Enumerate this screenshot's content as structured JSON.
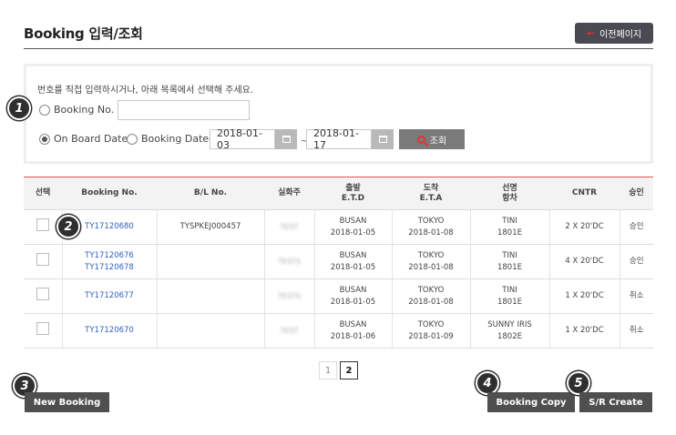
{
  "header": {
    "title": "Booking 입력/조회",
    "back_label": "이전페이지"
  },
  "search": {
    "hint": "번호를 직접 입력하시거나, 아래 목록에서 선택해 주세요.",
    "booking_no_label": "Booking No.",
    "booking_no_value": "",
    "on_board_label": "On Board Date",
    "booking_date_label": "Booking Date",
    "date_from": "2018-01-03",
    "tilde": "~",
    "date_to": "2018-01-17",
    "search_label": "조회"
  },
  "table": {
    "headers": [
      {
        "l1": "선택",
        "l2": ""
      },
      {
        "l1": "Booking No.",
        "l2": ""
      },
      {
        "l1": "B/L No.",
        "l2": ""
      },
      {
        "l1": "실화주",
        "l2": ""
      },
      {
        "l1": "출발",
        "l2": "E.T.D"
      },
      {
        "l1": "도착",
        "l2": "E.T.A"
      },
      {
        "l1": "선명",
        "l2": "항차"
      },
      {
        "l1": "CNTR",
        "l2": ""
      },
      {
        "l1": "승인",
        "l2": ""
      }
    ],
    "rows": [
      {
        "booking1": "TY17120680",
        "booking2": "",
        "bl": "TYSPKEJ000457",
        "shipper": "TEST",
        "etd_port": "BUSAN",
        "etd_date": "2018-01-05",
        "eta_port": "TOKYO",
        "eta_date": "2018-01-08",
        "vessel": "TINI",
        "voyage": "1801E",
        "cntr": "2 X 20'DC",
        "status": "승인"
      },
      {
        "booking1": "TY17120676",
        "booking2": "TY17120678",
        "bl": "",
        "shipper": "TESTS",
        "etd_port": "BUSAN",
        "etd_date": "2018-01-05",
        "eta_port": "TOKYO",
        "eta_date": "2018-01-08",
        "vessel": "TINI",
        "voyage": "1801E",
        "cntr": "4 X 20'DC",
        "status": "승인"
      },
      {
        "booking1": "TY17120677",
        "booking2": "",
        "bl": "",
        "shipper": "TESTS",
        "etd_port": "BUSAN",
        "etd_date": "2018-01-05",
        "eta_port": "TOKYO",
        "eta_date": "2018-01-08",
        "vessel": "TINI",
        "voyage": "1801E",
        "cntr": "1 X 20'DC",
        "status": "취소"
      },
      {
        "booking1": "TY17120670",
        "booking2": "",
        "bl": "",
        "shipper": "TEST",
        "etd_port": "BUSAN",
        "etd_date": "2018-01-06",
        "eta_port": "TOKYO",
        "eta_date": "2018-01-09",
        "vessel": "SUNNY IRIS",
        "voyage": "1802E",
        "cntr": "1 X 20'DC",
        "status": "취소"
      }
    ]
  },
  "pagination": {
    "pages": [
      "1",
      "2"
    ],
    "current": "2"
  },
  "actions": {
    "new_booking": "New Booking",
    "booking_copy": "Booking Copy",
    "sr_create": "S/R Create"
  },
  "badges": [
    "1",
    "2",
    "3",
    "4",
    "5"
  ]
}
